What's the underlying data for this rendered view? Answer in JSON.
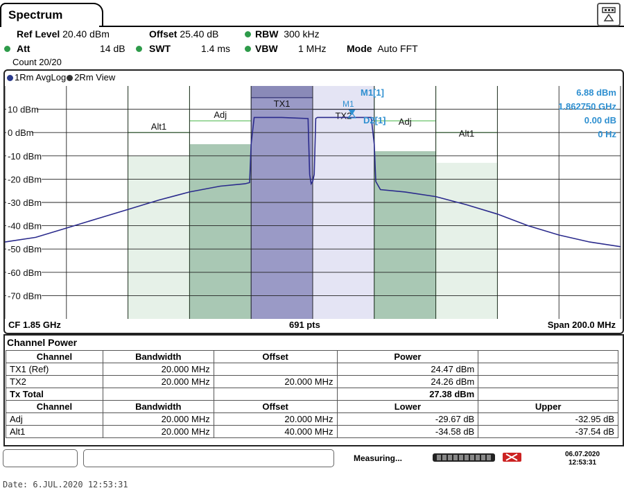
{
  "tab": {
    "title": "Spectrum"
  },
  "settings": {
    "ref_level_label": "Ref Level",
    "ref_level_value": "20.40 dBm",
    "offset_label": "Offset",
    "offset_value": "25.40 dB",
    "rbw_label": "RBW",
    "rbw_value": "300 kHz",
    "att_label": "Att",
    "att_value": "14 dB",
    "swt_label": "SWT",
    "swt_value": "1.4 ms",
    "vbw_label": "VBW",
    "vbw_value": "1 MHz",
    "mode_label": "Mode",
    "mode_value": "Auto FFT",
    "count": "Count 20/20"
  },
  "trace_legend": {
    "trace1": "1Rm AvgLog",
    "trace2": "2Rm View"
  },
  "marker_readout": {
    "m1_label": "M1[1]",
    "m1_level": "6.88 dBm",
    "m1_freq": "1.862750 GHz",
    "d2_label": "D2[1]",
    "d2_level": "0.00 dB",
    "d2_freq": "0 Hz",
    "m1_tag": "M1",
    "d2_tag": "D2"
  },
  "plot_footer": {
    "cf": "CF 1.85 GHz",
    "pts": "691 pts",
    "span": "Span 200.0 MHz"
  },
  "chart_data": {
    "type": "line",
    "ylim": [
      -80,
      20
    ],
    "y_ticks": [
      10,
      0,
      -10,
      -20,
      -30,
      -40,
      -50,
      -60,
      -70
    ],
    "y_tick_labels": [
      "10 dBm",
      "0 dBm",
      "-10 dBm",
      "-20 dBm",
      "-30 dBm",
      "-40 dBm",
      "-50 dBm",
      "-60 dBm",
      "-70 dBm"
    ],
    "x_center_GHz": 1.85,
    "x_span_MHz": 200,
    "channels": [
      {
        "label": "Alt1",
        "start_MHz": -60,
        "stop_MHz": -40,
        "limit_dBm": -10,
        "bar_dBm": 0
      },
      {
        "label": "Adj",
        "start_MHz": -40,
        "stop_MHz": -20,
        "limit_dBm": -5,
        "bar_dBm": 5
      },
      {
        "label": "TX1",
        "start_MHz": -20,
        "stop_MHz": 0,
        "limit_dBm": 15
      },
      {
        "label": "TX2",
        "start_MHz": 0,
        "stop_MHz": 20,
        "limit_dBm": 10
      },
      {
        "label": "Adj",
        "start_MHz": 20,
        "stop_MHz": 40,
        "limit_dBm": -8,
        "bar_dBm": 5
      },
      {
        "label": "Alt1",
        "start_MHz": 40,
        "stop_MHz": 60,
        "limit_dBm": -13,
        "bar_dBm": 0
      }
    ],
    "series": [
      {
        "x_MHz": [
          -100,
          -90,
          -80,
          -70,
          -60,
          -50,
          -40,
          -30,
          -22,
          -20.5,
          -20,
          -19,
          -10,
          -1.5,
          -1,
          -0.5,
          0,
          0.5,
          1,
          1.5,
          10,
          19,
          20,
          20.5,
          22,
          30,
          40,
          50,
          60,
          70,
          80,
          90,
          100
        ],
        "y_dBm": [
          -47,
          -45,
          -41,
          -37,
          -33,
          -29,
          -25.5,
          -23,
          -22,
          -21.5,
          -5,
          6.5,
          6.5,
          6,
          -18,
          -22,
          -21,
          -18,
          6,
          6.5,
          6.5,
          6.5,
          -5,
          -21,
          -24.5,
          -25.5,
          -27.5,
          -31,
          -35,
          -40,
          -44,
          -47,
          -49
        ]
      }
    ],
    "markers": [
      {
        "name": "M1",
        "x_MHz": 12.75,
        "y_dBm": 6.88
      }
    ]
  },
  "channel_power": {
    "title": "Channel Power",
    "headers1": [
      "Channel",
      "Bandwidth",
      "Offset",
      "Power",
      ""
    ],
    "rows1": [
      [
        "TX1 (Ref)",
        "20.000 MHz",
        "",
        "24.47 dBm",
        ""
      ],
      [
        "TX2",
        "20.000 MHz",
        "20.000 MHz",
        "24.26 dBm",
        ""
      ]
    ],
    "total_label": "Tx Total",
    "total_value": "27.38 dBm",
    "headers2": [
      "Channel",
      "Bandwidth",
      "Offset",
      "Lower",
      "Upper"
    ],
    "rows2": [
      [
        "Adj",
        "20.000 MHz",
        "20.000 MHz",
        "-29.67 dB",
        "-32.95 dB"
      ],
      [
        "Alt1",
        "20.000 MHz",
        "40.000 MHz",
        "-34.58 dB",
        "-37.54 dB"
      ]
    ]
  },
  "status_bar": {
    "measuring": "Measuring...",
    "date": "06.07.2020",
    "time": "12:53:31"
  },
  "date_footer": "Date: 6.JUL.2020  12:53:31",
  "colors": {
    "trace": "#2a2a8c",
    "tx1_fill": "#9a9ac6",
    "tx2_fill": "#e4e4f4",
    "adj_fill": "#a9c8b4",
    "alt_fill": "#e6f1e8",
    "channel_line": "#6bc46b",
    "marker_text": "#2e8fd0",
    "indicator": "#2e9b4a"
  }
}
